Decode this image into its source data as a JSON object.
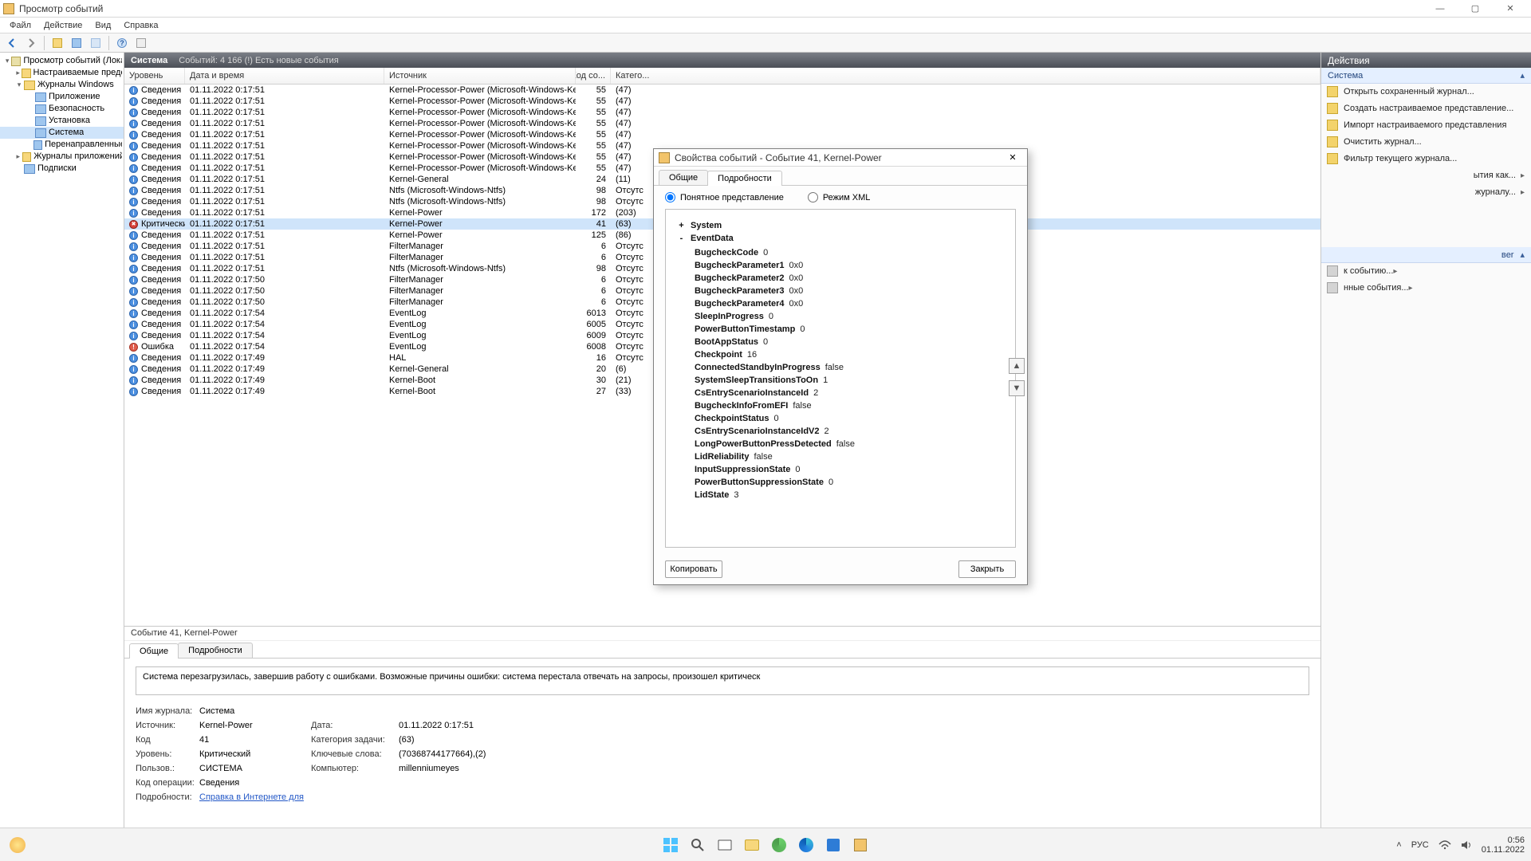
{
  "window": {
    "title": "Просмотр событий",
    "min": "—",
    "max": "▢",
    "close": "✕"
  },
  "menu": [
    "Файл",
    "Действие",
    "Вид",
    "Справка"
  ],
  "tree": {
    "root": "Просмотр событий (Локальн",
    "nodes": [
      {
        "indent": 0,
        "caret": "▾",
        "icon": "root",
        "label": "Просмотр событий (Локальн"
      },
      {
        "indent": 1,
        "caret": "▸",
        "icon": "folder",
        "label": "Настраиваемые представле"
      },
      {
        "indent": 1,
        "caret": "▾",
        "icon": "folder",
        "label": "Журналы Windows"
      },
      {
        "indent": 2,
        "caret": "",
        "icon": "log",
        "label": "Приложение"
      },
      {
        "indent": 2,
        "caret": "",
        "icon": "log",
        "label": "Безопасность"
      },
      {
        "indent": 2,
        "caret": "",
        "icon": "log",
        "label": "Установка"
      },
      {
        "indent": 2,
        "caret": "",
        "icon": "log",
        "label": "Система",
        "selected": true
      },
      {
        "indent": 2,
        "caret": "",
        "icon": "log",
        "label": "Перенаправленные соб"
      },
      {
        "indent": 1,
        "caret": "▸",
        "icon": "folder",
        "label": "Журналы приложений и сл"
      },
      {
        "indent": 1,
        "caret": "",
        "icon": "log",
        "label": "Подписки"
      }
    ]
  },
  "banner": {
    "title": "Система",
    "sub": "Событий: 4 166 (!) Есть новые события"
  },
  "grid": {
    "headers": {
      "level": "Уровень",
      "date": "Дата и время",
      "src": "Источник",
      "code": "Код со...",
      "cat": "Катего..."
    },
    "level_labels": {
      "info": "Сведения",
      "err": "Ошибка",
      "crit": "Критический"
    },
    "rows": [
      {
        "lvl": "info",
        "date": "01.11.2022 0:17:51",
        "src": "Kernel-Processor-Power (Microsoft-Windows-Kernel-Pr...",
        "code": "55",
        "cat": "(47)"
      },
      {
        "lvl": "info",
        "date": "01.11.2022 0:17:51",
        "src": "Kernel-Processor-Power (Microsoft-Windows-Kernel-Pr...",
        "code": "55",
        "cat": "(47)"
      },
      {
        "lvl": "info",
        "date": "01.11.2022 0:17:51",
        "src": "Kernel-Processor-Power (Microsoft-Windows-Kernel-Pr...",
        "code": "55",
        "cat": "(47)"
      },
      {
        "lvl": "info",
        "date": "01.11.2022 0:17:51",
        "src": "Kernel-Processor-Power (Microsoft-Windows-Kernel-Pr...",
        "code": "55",
        "cat": "(47)"
      },
      {
        "lvl": "info",
        "date": "01.11.2022 0:17:51",
        "src": "Kernel-Processor-Power (Microsoft-Windows-Kernel-Pr...",
        "code": "55",
        "cat": "(47)"
      },
      {
        "lvl": "info",
        "date": "01.11.2022 0:17:51",
        "src": "Kernel-Processor-Power (Microsoft-Windows-Kernel-Pr...",
        "code": "55",
        "cat": "(47)"
      },
      {
        "lvl": "info",
        "date": "01.11.2022 0:17:51",
        "src": "Kernel-Processor-Power (Microsoft-Windows-Kernel-Pr...",
        "code": "55",
        "cat": "(47)"
      },
      {
        "lvl": "info",
        "date": "01.11.2022 0:17:51",
        "src": "Kernel-Processor-Power (Microsoft-Windows-Kernel-Pr...",
        "code": "55",
        "cat": "(47)"
      },
      {
        "lvl": "info",
        "date": "01.11.2022 0:17:51",
        "src": "Kernel-General",
        "code": "24",
        "cat": "(11)"
      },
      {
        "lvl": "info",
        "date": "01.11.2022 0:17:51",
        "src": "Ntfs (Microsoft-Windows-Ntfs)",
        "code": "98",
        "cat": "Отсутс"
      },
      {
        "lvl": "info",
        "date": "01.11.2022 0:17:51",
        "src": "Ntfs (Microsoft-Windows-Ntfs)",
        "code": "98",
        "cat": "Отсутс"
      },
      {
        "lvl": "info",
        "date": "01.11.2022 0:17:51",
        "src": "Kernel-Power",
        "code": "172",
        "cat": "(203)"
      },
      {
        "lvl": "crit",
        "date": "01.11.2022 0:17:51",
        "src": "Kernel-Power",
        "code": "41",
        "cat": "(63)",
        "selected": true
      },
      {
        "lvl": "info",
        "date": "01.11.2022 0:17:51",
        "src": "Kernel-Power",
        "code": "125",
        "cat": "(86)"
      },
      {
        "lvl": "info",
        "date": "01.11.2022 0:17:51",
        "src": "FilterManager",
        "code": "6",
        "cat": "Отсутс"
      },
      {
        "lvl": "info",
        "date": "01.11.2022 0:17:51",
        "src": "FilterManager",
        "code": "6",
        "cat": "Отсутс"
      },
      {
        "lvl": "info",
        "date": "01.11.2022 0:17:51",
        "src": "Ntfs (Microsoft-Windows-Ntfs)",
        "code": "98",
        "cat": "Отсутс"
      },
      {
        "lvl": "info",
        "date": "01.11.2022 0:17:50",
        "src": "FilterManager",
        "code": "6",
        "cat": "Отсутс"
      },
      {
        "lvl": "info",
        "date": "01.11.2022 0:17:50",
        "src": "FilterManager",
        "code": "6",
        "cat": "Отсутс"
      },
      {
        "lvl": "info",
        "date": "01.11.2022 0:17:50",
        "src": "FilterManager",
        "code": "6",
        "cat": "Отсутс"
      },
      {
        "lvl": "info",
        "date": "01.11.2022 0:17:54",
        "src": "EventLog",
        "code": "6013",
        "cat": "Отсутс"
      },
      {
        "lvl": "info",
        "date": "01.11.2022 0:17:54",
        "src": "EventLog",
        "code": "6005",
        "cat": "Отсутс"
      },
      {
        "lvl": "info",
        "date": "01.11.2022 0:17:54",
        "src": "EventLog",
        "code": "6009",
        "cat": "Отсутс"
      },
      {
        "lvl": "err",
        "date": "01.11.2022 0:17:54",
        "src": "EventLog",
        "code": "6008",
        "cat": "Отсутс"
      },
      {
        "lvl": "info",
        "date": "01.11.2022 0:17:49",
        "src": "HAL",
        "code": "16",
        "cat": "Отсутс"
      },
      {
        "lvl": "info",
        "date": "01.11.2022 0:17:49",
        "src": "Kernel-General",
        "code": "20",
        "cat": "(6)"
      },
      {
        "lvl": "info",
        "date": "01.11.2022 0:17:49",
        "src": "Kernel-Boot",
        "code": "30",
        "cat": "(21)"
      },
      {
        "lvl": "info",
        "date": "01.11.2022 0:17:49",
        "src": "Kernel-Boot",
        "code": "27",
        "cat": "(33)"
      }
    ]
  },
  "detail": {
    "title": "Событие 41, Kernel-Power",
    "tabs": {
      "general": "Общие",
      "details": "Подробности"
    },
    "message": "Система перезагрузилась, завершив работу с ошибками. Возможные причины ошибки: система перестала отвечать на запросы, произошел критическ",
    "kv": {
      "log_k": "Имя журнала:",
      "log_v": "Система",
      "src_k": "Источник:",
      "src_v": "Kernel-Power",
      "date_k": "Дата:",
      "date_v": "01.11.2022 0:17:51",
      "code_k": "Код",
      "code_v": "41",
      "cat_k": "Категория задачи:",
      "cat_v": "(63)",
      "lvl_k": "Уровень:",
      "lvl_v": "Критический",
      "kw_k": "Ключевые слова:",
      "kw_v": "(70368744177664),(2)",
      "usr_k": "Пользов.:",
      "usr_v": "СИСТЕМА",
      "cmp_k": "Компьютер:",
      "cmp_v": "millenniumeyes",
      "op_k": "Код операции:",
      "op_v": "Сведения",
      "more_k": "Подробности:",
      "more_v": "Справка в Интернете для "
    }
  },
  "actions": {
    "title": "Действия",
    "section1": "Система",
    "items1": [
      "Открыть сохраненный журнал...",
      "Создать настраиваемое представление...",
      "Импорт настраиваемого представления",
      "Очистить журнал...",
      "Фильтр текущего журнала..."
    ],
    "hidden_items": [
      "ытия как...",
      "журналу..."
    ],
    "section2_suffix": "вer",
    "items2": [
      "к событию...",
      "нные события..."
    ]
  },
  "dialog": {
    "title": "Свойства событий - Событие 41, Kernel-Power",
    "tabs": {
      "general": "Общие",
      "details": "Подробности"
    },
    "radio": {
      "friendly": "Понятное представление",
      "xml": "Режим XML"
    },
    "nodes": {
      "system": "System",
      "eventdata": "EventData"
    },
    "data": [
      {
        "k": "BugcheckCode",
        "v": "0"
      },
      {
        "k": "BugcheckParameter1",
        "v": "0x0"
      },
      {
        "k": "BugcheckParameter2",
        "v": "0x0"
      },
      {
        "k": "BugcheckParameter3",
        "v": "0x0"
      },
      {
        "k": "BugcheckParameter4",
        "v": "0x0"
      },
      {
        "k": "SleepInProgress",
        "v": "0"
      },
      {
        "k": "PowerButtonTimestamp",
        "v": "0"
      },
      {
        "k": "BootAppStatus",
        "v": "0"
      },
      {
        "k": "Checkpoint",
        "v": "16"
      },
      {
        "k": "ConnectedStandbyInProgress",
        "v": "false"
      },
      {
        "k": "SystemSleepTransitionsToOn",
        "v": "1"
      },
      {
        "k": "CsEntryScenarioInstanceId",
        "v": "2"
      },
      {
        "k": "BugcheckInfoFromEFI",
        "v": "false"
      },
      {
        "k": "CheckpointStatus",
        "v": "0"
      },
      {
        "k": "CsEntryScenarioInstanceIdV2",
        "v": "2"
      },
      {
        "k": "LongPowerButtonPressDetected",
        "v": "false"
      },
      {
        "k": "LidReliability",
        "v": "false"
      },
      {
        "k": "InputSuppressionState",
        "v": "0"
      },
      {
        "k": "PowerButtonSuppressionState",
        "v": "0"
      },
      {
        "k": "LidState",
        "v": "3"
      }
    ],
    "copy": "Копировать",
    "close": "Закрыть"
  },
  "taskbar": {
    "lang": "РУС",
    "time": "0:56",
    "date": "01.11.2022"
  }
}
